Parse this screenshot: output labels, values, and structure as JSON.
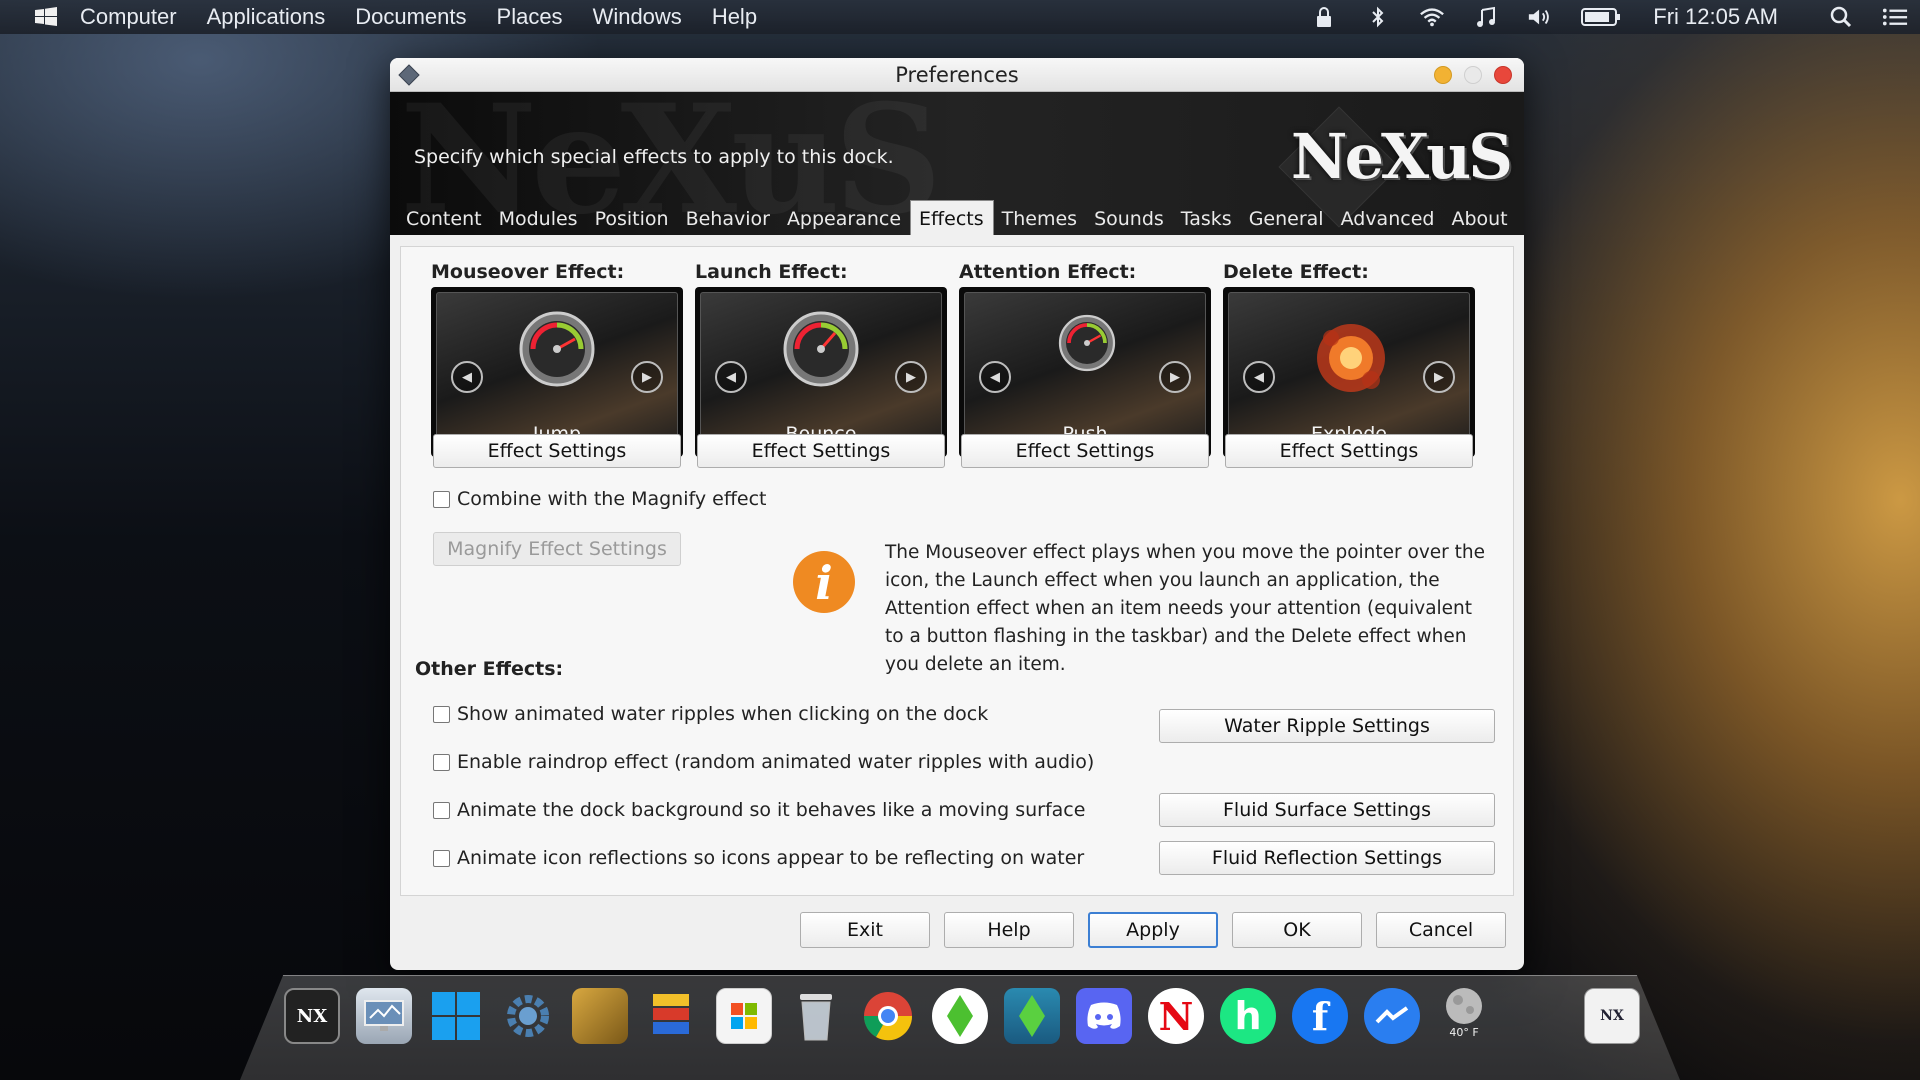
{
  "menubar": {
    "items": [
      "Computer",
      "Applications",
      "Documents",
      "Places",
      "Windows",
      "Help"
    ],
    "clock": "Fri 12:05 AM"
  },
  "window": {
    "title": "Preferences",
    "description": "Specify which special effects to apply to this dock.",
    "brand": "NeXuS"
  },
  "tabs": [
    "Content",
    "Modules",
    "Position",
    "Behavior",
    "Appearance",
    "Effects",
    "Themes",
    "Sounds",
    "Tasks",
    "General",
    "Advanced",
    "About"
  ],
  "active_tab": "Effects",
  "effects": [
    {
      "heading": "Mouseover Effect:",
      "name": "Jump",
      "settings": "Effect Settings"
    },
    {
      "heading": "Launch Effect:",
      "name": "Bounce",
      "settings": "Effect Settings"
    },
    {
      "heading": "Attention Effect:",
      "name": "Push",
      "settings": "Effect Settings"
    },
    {
      "heading": "Delete Effect:",
      "name": "Explode",
      "settings": "Effect Settings"
    }
  ],
  "magnify": {
    "checkbox_label": "Combine with the Magnify effect",
    "checked": false,
    "settings_button": "Magnify Effect Settings"
  },
  "info_text": "The Mouseover effect plays when you move the pointer over the icon, the Launch effect when you launch an application, the Attention effect when an item needs your attention (equivalent to a button flashing in the taskbar) and the Delete effect when you delete an item.",
  "other_effects": {
    "title": "Other Effects:",
    "options": [
      {
        "label": "Show animated water ripples when clicking on the dock",
        "checked": false
      },
      {
        "label": "Enable raindrop effect (random animated water ripples with audio)",
        "checked": false
      },
      {
        "label": "Animate the dock background so it behaves like a moving surface",
        "checked": false
      },
      {
        "label": "Animate icon reflections so icons appear to be reflecting on water",
        "checked": false
      }
    ],
    "water_ripple_button": "Water Ripple Settings",
    "fluid_surface_button": "Fluid Surface Settings",
    "fluid_reflection_button": "Fluid Reflection Settings"
  },
  "footer_buttons": {
    "exit": "Exit",
    "help": "Help",
    "apply": "Apply",
    "ok": "OK",
    "cancel": "Cancel"
  },
  "dock": {
    "weather": "40° F",
    "icons": [
      "nexus-logo-icon",
      "monitor-icon",
      "windows-icon",
      "gear-icon",
      "folder-icon",
      "books-icon",
      "store-icon",
      "recycle-bin-icon",
      "chrome-icon",
      "sims-icon",
      "sims-blue-icon",
      "discord-icon",
      "netflix-icon",
      "hulu-icon",
      "facebook-icon",
      "messenger-icon",
      "weather-icon",
      "nexus-preferences-icon"
    ]
  },
  "colors": {
    "accent": "#3c7fd3",
    "info_orange": "#ef8a22",
    "close": "#e8473b",
    "minimize": "#f2b233"
  }
}
